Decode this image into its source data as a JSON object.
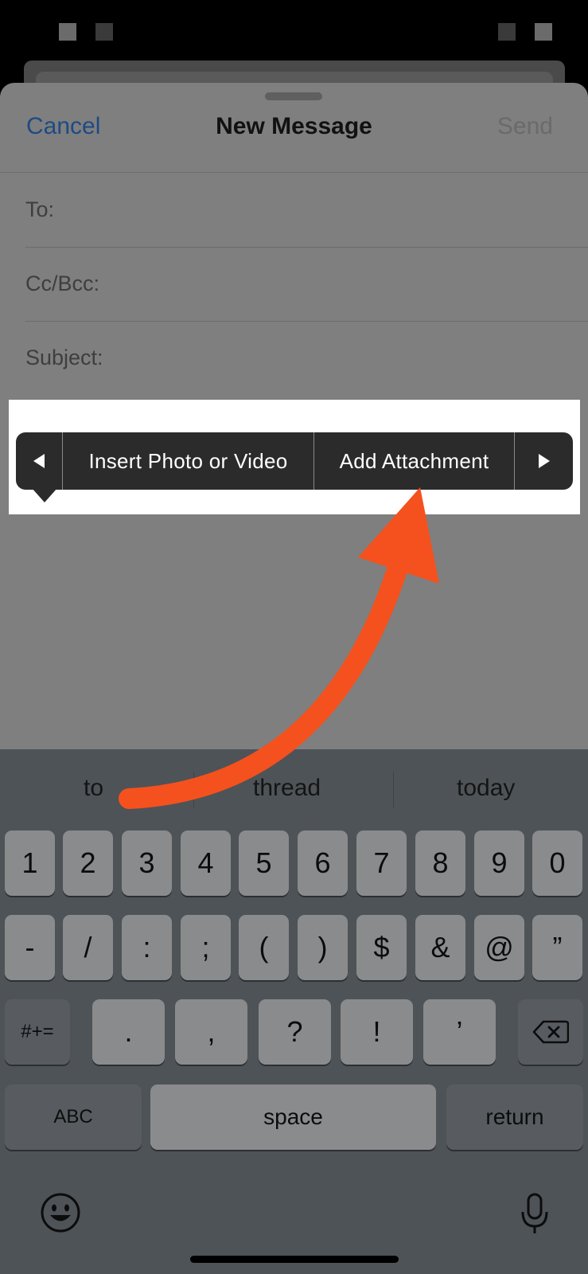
{
  "header": {
    "cancel_label": "Cancel",
    "title": "New Message",
    "send_label": "Send"
  },
  "fields": {
    "to_label": "To:",
    "cc_label": "Cc/Bcc:",
    "subject_label": "Subject:"
  },
  "context_menu": {
    "items": [
      "Insert Photo or Video",
      "Add Attachment"
    ],
    "prev_icon": "left-triangle-icon",
    "next_icon": "right-triangle-icon"
  },
  "annotation": {
    "arrow_color": "#f4511e",
    "highlight_color": "#ffffff"
  },
  "keyboard": {
    "suggestions": [
      "to",
      "thread",
      "today"
    ],
    "row1": [
      "1",
      "2",
      "3",
      "4",
      "5",
      "6",
      "7",
      "8",
      "9",
      "0"
    ],
    "row2": [
      "-",
      "/",
      ":",
      ";",
      "(",
      ")",
      "$",
      "&",
      "@",
      "”"
    ],
    "row3": [
      ".",
      ",",
      "?",
      "!",
      "’"
    ],
    "symbols_label": "#+=",
    "abc_label": "ABC",
    "space_label": "space",
    "return_label": "return",
    "delete_icon": "backspace-icon",
    "emoji_icon": "emoji-icon",
    "mic_icon": "microphone-icon"
  }
}
